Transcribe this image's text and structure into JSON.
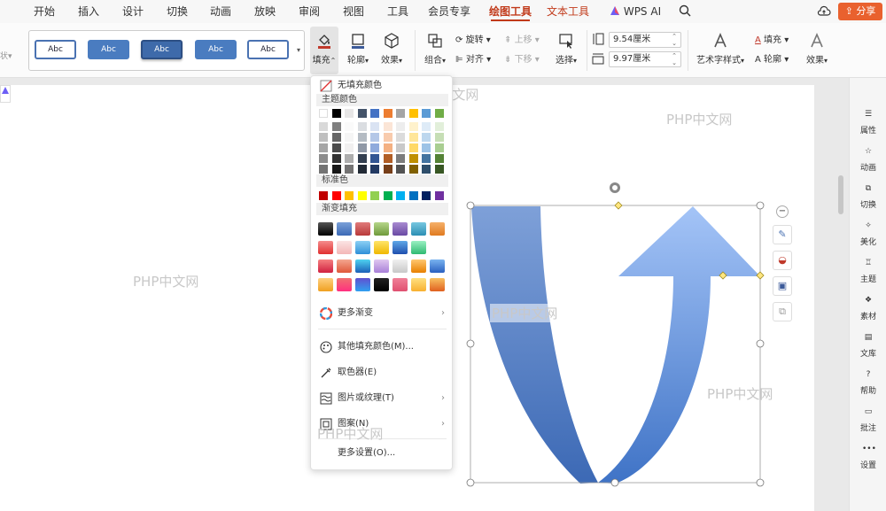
{
  "menu": {
    "tabs": [
      "开始",
      "插入",
      "设计",
      "切换",
      "动画",
      "放映",
      "审阅",
      "视图",
      "工具",
      "会员专享",
      "绘图工具",
      "文本工具",
      "WPS AI"
    ],
    "share_label": "分享"
  },
  "ribbon": {
    "style_cards": [
      "Abc",
      "Abc",
      "Abc",
      "Abc",
      "Abc"
    ],
    "fill_label": "填充",
    "outline_label": "轮廓",
    "effect_label": "效果",
    "group_label": "组合",
    "rotate_label": "旋转",
    "align_label": "对齐",
    "move_up_label": "上移",
    "move_down_label": "下移",
    "select_label": "选择",
    "height_value": "9.54厘米",
    "width_value": "9.97厘米",
    "art_text_label": "艺术字样式",
    "text_fill_label": "填充",
    "text_outline_label": "轮廓",
    "text_effect_label": "效果"
  },
  "fill_menu": {
    "no_fill": "无填充颜色",
    "theme_colors_title": "主题颜色",
    "standard_colors_title": "标准色",
    "gradient_title": "渐变填充",
    "more_gradient": "更多渐变",
    "other_fill": "其他填充颜色(M)...",
    "eyedropper": "取色器(E)",
    "picture_texture": "图片或纹理(T)",
    "pattern": "图案(N)",
    "more_settings": "更多设置(O)...",
    "theme_top_row": [
      "#ffffff",
      "#000000",
      "#e7e6e6",
      "#44546a",
      "#4472c4",
      "#ed7d31",
      "#a5a5a5",
      "#ffc000",
      "#5b9bd5",
      "#70ad47"
    ],
    "standard_colors": [
      "#c00000",
      "#ff0000",
      "#ffc000",
      "#ffff00",
      "#92d050",
      "#00b050",
      "#00b0f0",
      "#0070c0",
      "#002060",
      "#7030a0"
    ]
  },
  "side_panel": {
    "items": [
      "属性",
      "动画",
      "切换",
      "美化",
      "主题",
      "素材",
      "文库",
      "帮助",
      "批注",
      "设置"
    ]
  },
  "watermarks": [
    "PHP中文网",
    "PHP中文网",
    "PHP中文网",
    "PHP中文网",
    "PHP中文网",
    "PHP中文网"
  ],
  "colors": {
    "accent": "#c13a1a",
    "share": "#e9612e",
    "shape_light": "#9fc0f5",
    "shape_dark": "#3c69b5"
  }
}
